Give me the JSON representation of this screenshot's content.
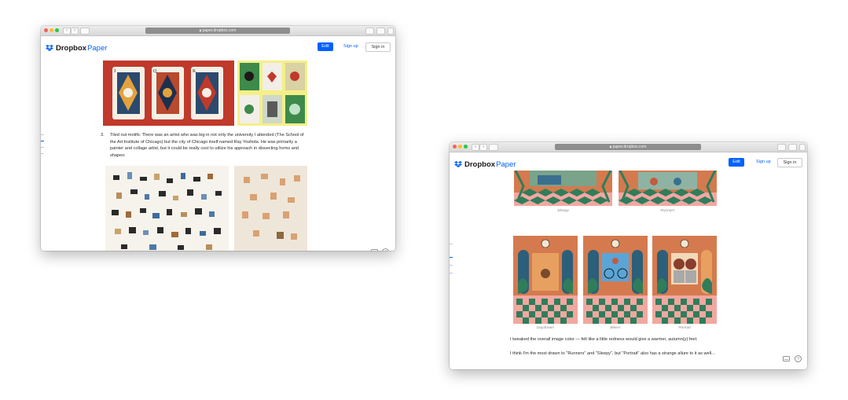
{
  "left_window": {
    "url": "paper.dropbox.com",
    "logo": {
      "brand": "Dropbox",
      "product": "Paper"
    },
    "buttons": {
      "edit": "Edit",
      "sign_up": "Sign up",
      "sign_in": "Sign in"
    },
    "list_number": "3.",
    "paragraph": "Tiled out motifs: There was an artist who was big in not only the university I attended (The School of the Art Institute of Chicago) but the city of Chicago itself named Ray Yoshida. He was primarily a painter and collage artist, but it could be really cool to utilize his approach in dissecting forms and shapes:",
    "card_labels": [
      "J",
      "Q",
      "K"
    ]
  },
  "right_window": {
    "url": "paper.dropbox.com",
    "logo": {
      "brand": "Dropbox",
      "product": "Paper"
    },
    "buttons": {
      "edit": "Edit",
      "sign_up": "Sign up",
      "sign_in": "Sign in"
    },
    "captions_top": [
      "Sleepy",
      "Runners"
    ],
    "captions_bottom": [
      "Daydream",
      "Bikers",
      "Portrait"
    ],
    "paragraph1": "I tweaked the overall image color — felt like a little redness would give a warmer, autumn(y) feel.",
    "paragraph2": "I think I'm the most drawn to \"Runners\" and \"Sleepy\", but \"Portrait\" also has a strange allure to it as well..."
  },
  "colors": {
    "accent": "#0061fe",
    "card_bg": "#c0392b",
    "terracotta": "#d47a4e",
    "floor_green": "#2f7d5b",
    "floor_pink": "#f2a7a0"
  }
}
